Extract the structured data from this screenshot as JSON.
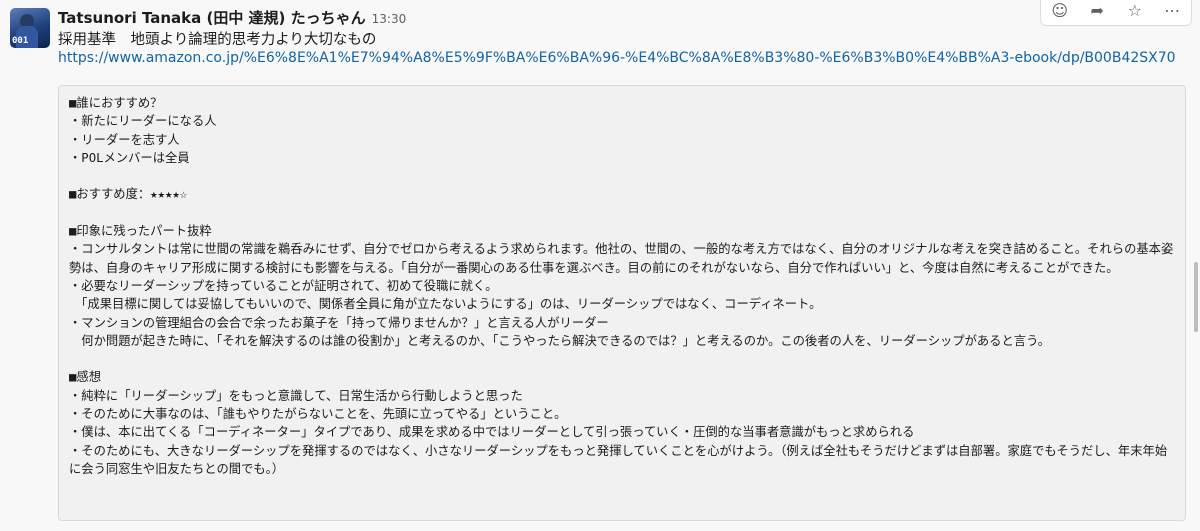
{
  "message": {
    "author": "Tatsunori Tanaka (田中 達規) たっちゃん",
    "time": "13:30",
    "avatar_number": "001",
    "text": "採用基準　地頭より論理的思考力より大切なもの",
    "link": "https://www.amazon.co.jp/%E6%8E%A1%E7%94%A8%E5%9F%BA%E6%BA%96-%E4%BC%8A%E8%B3%80-%E6%B3%B0%E4%BB%A3-ebook/dp/B00B42SX70"
  },
  "toolbar": {
    "icons": [
      "add-reaction-icon",
      "share-icon",
      "star-icon",
      "more-icon"
    ],
    "glyphs": [
      "☺",
      "➦",
      "☆",
      "⋯"
    ]
  },
  "code_block": {
    "lines": [
      "■誰におすすめ？",
      "・新たにリーダーになる人",
      "・リーダーを志す人",
      "・POLメンバーは全員",
      "",
      "■おすすめ度：★★★★☆",
      "",
      "■印象に残ったパート抜粋",
      "・コンサルタントは常に世間の常識を鵜呑みにせず、自分でゼロから考えるよう求められます。他社の、世間の、一般的な考え方ではなく、自分のオリジナルな考えを突き詰めること。それらの基本姿勢は、自身のキャリア形成に関する検討にも影響を与える。「自分が一番関心のある仕事を選ぶべき。目の前にのそれがないなら、自分で作ればいい」と、今度は自然に考えることができた。",
      "・必要なリーダーシップを持っていることが証明されて、初めて役職に就く。",
      "　「成果目標に関しては妥協してもいいので、関係者全員に角が立たないようにする」のは、リーダーシップではなく、コーディネート。",
      "・マンションの管理組合の会合で余ったお菓子を「持って帰りませんか？」と言える人がリーダー",
      "　何か問題が起きた時に、「それを解決するのは誰の役割か」と考えるのか、「こうやったら解決できるのでは？」と考えるのか。この後者の人を、リーダーシップがあると言う。",
      "",
      "■感想",
      "・純粋に「リーダーシップ」をもっと意識して、日常生活から行動しようと思った",
      "・そのために大事なのは、「誰もやりたがらないことを、先頭に立ってやる」ということ。",
      "・僕は、本に出てくる「コーディネーター」タイプであり、成果を求める中ではリーダーとして引っ張っていく・圧倒的な当事者意識がもっと求められる",
      "・そのためにも、大きなリーダーシップを発揮するのではなく、小さなリーダーシップをもっと発揮していくことを心がけよう。（例えば全社もそうだけどまずは自部署。家庭でもそうだし、年末年始に会う同窓生や旧友たちとの間でも。）"
    ]
  }
}
